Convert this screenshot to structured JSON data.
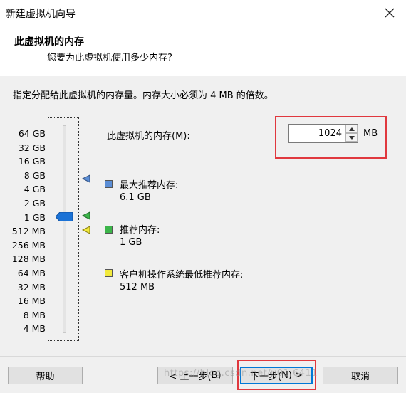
{
  "window": {
    "title": "新建虚拟机向导",
    "close_label": "×"
  },
  "header": {
    "title": "此虚拟机的内存",
    "subtitle": "您要为此虚拟机使用多少内存?"
  },
  "main": {
    "instruction": "指定分配给此虚拟机的内存量。内存大小必须为 4 MB 的倍数。",
    "memory_label_prefix": "此虚拟机的内存(",
    "memory_label_mnemonic": "M",
    "memory_label_suffix": "):",
    "memory_value": "1024",
    "memory_unit": "MB",
    "slider_selected": "1 GB",
    "slider_ticks": [
      "64 GB",
      "32 GB",
      "16 GB",
      "8 GB",
      "4 GB",
      "2 GB",
      "1 GB",
      "512 MB",
      "256 MB",
      "128 MB",
      "64 MB",
      "32 MB",
      "16 MB",
      "8 MB",
      "4 MB"
    ],
    "legend": [
      {
        "title": "最大推荐内存:",
        "value": "6.1 GB",
        "color": "#5b8ed6"
      },
      {
        "title": "推荐内存:",
        "value": "1 GB",
        "color": "#3cb54a"
      },
      {
        "title": "客户机操作系统最低推荐内存:",
        "value": "512 MB",
        "color": "#f2ea3c"
      }
    ],
    "thumb_color": "#1b72d6"
  },
  "footer": {
    "help_label": "帮助",
    "back_prefix": "< 上一步(",
    "back_mnemonic": "B",
    "back_suffix": ")",
    "next_prefix": "下一步(",
    "next_mnemonic": "N",
    "next_suffix": ") >",
    "cancel_label": "取消",
    "watermark": "https://blog.csdn.net/u01 6411"
  },
  "highlight_color": "#e0383e"
}
